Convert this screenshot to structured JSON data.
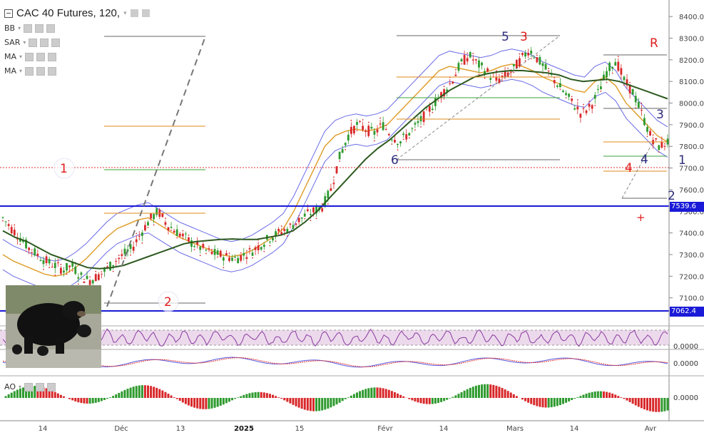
{
  "header": {
    "title": "CAC 40 Futures, 120,",
    "indicators": [
      "BB",
      "SAR",
      "MA",
      "MA"
    ]
  },
  "panes": {
    "oscillator_label": "AO"
  },
  "price_levels": {
    "upper": "7539.6",
    "lower": "7062.4"
  },
  "chart_data": [
    {
      "type": "line",
      "title": "CAC 40 Futures, 120,",
      "y_ticks": [
        7100,
        7200,
        7300,
        7400,
        7500,
        7600,
        7700,
        7800,
        7900,
        8000,
        8100,
        8200,
        8300,
        8400
      ],
      "ylim": [
        7000,
        8450
      ],
      "x_ticks": [
        "14",
        "Déc",
        "13",
        "2025",
        "15",
        "Févr",
        "14",
        "Mars",
        "14",
        "Avr"
      ],
      "series": [
        {
          "values": [
            7470,
            7420,
            7380,
            7330,
            7300,
            7270,
            7250,
            7230,
            7250,
            7200,
            7180,
            7200,
            7230,
            7270,
            7300,
            7330,
            7400,
            7460,
            7500,
            7440,
            7410,
            7380,
            7350,
            7330,
            7310,
            7300,
            7290,
            7280,
            7300,
            7320,
            7350,
            7380,
            7400,
            7420,
            7450,
            7480,
            7500,
            7520,
            7600,
            7750,
            7850,
            7900,
            7880,
            7860,
            7900,
            7850,
            7820,
            7860,
            7900,
            7950,
            8000,
            8050,
            8100,
            8180,
            8220,
            8180,
            8150,
            8100,
            8120,
            8150,
            8200,
            8250,
            8200,
            8150,
            8100,
            8050,
            8000,
            7950,
            7980,
            8050,
            8150,
            8200,
            8100,
            8050,
            7950,
            7850,
            7800,
            7820
          ]
        },
        {
          "values": [
            7410,
            7380,
            7360,
            7330,
            7300,
            7280,
            7260,
            7240,
            7235,
            7240,
            7250,
            7270,
            7290,
            7310,
            7330,
            7350,
            7360,
            7365,
            7370,
            7372,
            7370,
            7370,
            7380,
            7390,
            7410,
            7450,
            7500,
            7560,
            7620,
            7680,
            7740,
            7790,
            7830,
            7880,
            7930,
            7980,
            8020,
            8060,
            8090,
            8120,
            8135,
            8145,
            8150,
            8150,
            8145,
            8140,
            8130,
            8110,
            8100,
            8105,
            8110,
            8100,
            8080,
            8060,
            8040,
            8020
          ]
        },
        {
          "values": [
            7300,
            7270,
            7250,
            7230,
            7210,
            7200,
            7210,
            7240,
            7280,
            7330,
            7380,
            7420,
            7440,
            7460,
            7470,
            7440,
            7410,
            7380,
            7360,
            7340,
            7320,
            7300,
            7290,
            7300,
            7320,
            7350,
            7380,
            7420,
            7500,
            7600,
            7700,
            7800,
            7850,
            7870,
            7880,
            7870,
            7880,
            7900,
            7950,
            8000,
            8050,
            8100,
            8150,
            8170,
            8160,
            8150,
            8140,
            8150,
            8170,
            8180,
            8170,
            8150,
            8120,
            8100,
            8080,
            8060,
            8050,
            8100,
            8120,
            8080,
            8000,
            7950,
            7900,
            7850,
            7820
          ]
        }
      ]
    }
  ],
  "annotations": {
    "wave_labels": [
      "1",
      "2",
      "5",
      "3",
      "R",
      "6",
      "3",
      "4",
      "4",
      "1",
      "2",
      "+"
    ]
  },
  "oscillators": {
    "rsi_ticks": [
      "0.0000"
    ],
    "macd_ticks": [
      "0.0000"
    ],
    "ao_ticks": [
      "0.0000"
    ]
  },
  "colors": {
    "accent": "#1a1ad8",
    "ma_long": "#2d5a1f",
    "wave_red": "#e01b1b",
    "wave_blue": "#2b2b7a"
  }
}
